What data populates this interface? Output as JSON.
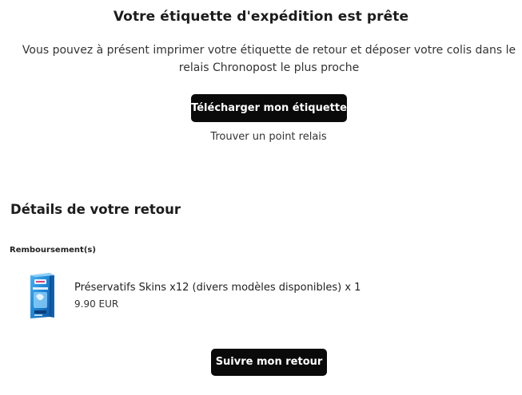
{
  "header": {
    "title": "Votre étiquette d'expédition est prête",
    "intro": "Vous pouvez à présent imprimer votre étiquette de retour et déposer votre colis dans le relais Chronopost le plus proche"
  },
  "actions": {
    "download_label": "Télécharger mon étiquette",
    "relay_link_label": "Trouver un point relais",
    "track_label": "Suivre mon retour"
  },
  "details": {
    "title": "Détails de votre retour",
    "refunds_label": "Remboursement(s)",
    "items": [
      {
        "name": "Préservatifs Skins x12 (divers modèles disponibles) x 1",
        "price": "9.90 EUR",
        "image_icon": "skins-condom-box-icon"
      }
    ]
  },
  "colors": {
    "button_bg": "#0a0a0a",
    "button_text": "#ffffff",
    "product_box_blue": "#1e88d8"
  }
}
